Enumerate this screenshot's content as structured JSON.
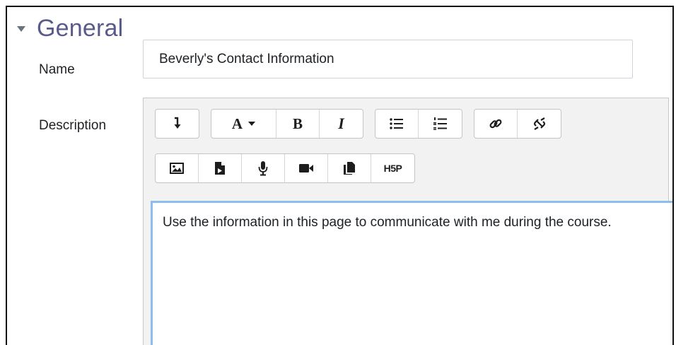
{
  "section": {
    "title": "General",
    "toggle_icon": "chevron-down-icon"
  },
  "fields": {
    "name_label": "Name",
    "name_value": "Beverly's Contact Information",
    "description_label": "Description"
  },
  "toolbar": {
    "row1": [
      {
        "name": "show-more-buttons-icon",
        "label": ""
      },
      {
        "name": "font-style-icon",
        "label": "A"
      },
      {
        "name": "bold-icon",
        "label": "B"
      },
      {
        "name": "italic-icon",
        "label": "I"
      },
      {
        "name": "unordered-list-icon",
        "label": ""
      },
      {
        "name": "ordered-list-icon",
        "label": ""
      },
      {
        "name": "link-icon",
        "label": ""
      },
      {
        "name": "unlink-icon",
        "label": ""
      }
    ],
    "row2": [
      {
        "name": "insert-image-icon",
        "label": ""
      },
      {
        "name": "insert-media-icon",
        "label": ""
      },
      {
        "name": "record-audio-icon",
        "label": ""
      },
      {
        "name": "record-video-icon",
        "label": ""
      },
      {
        "name": "manage-files-icon",
        "label": ""
      },
      {
        "name": "h5p-icon",
        "label": "H5P"
      }
    ],
    "font_label": "A",
    "bold_label": "B",
    "italic_label": "I"
  },
  "editor": {
    "content": "Use the information in this page to communicate with me during the course."
  },
  "colors": {
    "section_title": "#5a5a8a",
    "focus_border": "#8dbdf0",
    "toolbar_bg": "#f2f2f2"
  }
}
